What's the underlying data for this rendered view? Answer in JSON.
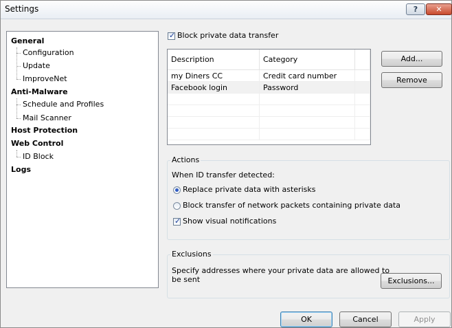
{
  "window": {
    "title": "Settings",
    "help_label": "?",
    "close_label": "✕"
  },
  "tree": [
    {
      "label": "General",
      "bold": true
    },
    {
      "label": "Configuration",
      "bold": false
    },
    {
      "label": "Update",
      "bold": false
    },
    {
      "label": "ImproveNet",
      "bold": false
    },
    {
      "label": "Anti-Malware",
      "bold": true
    },
    {
      "label": "Schedule and Profiles",
      "bold": false
    },
    {
      "label": "Mail Scanner",
      "bold": false
    },
    {
      "label": "Host Protection",
      "bold": true
    },
    {
      "label": "Web Control",
      "bold": true
    },
    {
      "label": "ID Block",
      "bold": false
    },
    {
      "label": "Logs",
      "bold": true
    }
  ],
  "block_transfer": {
    "label": "Block private data transfer",
    "checked": true
  },
  "table": {
    "columns": [
      "Description",
      "Category"
    ],
    "rows": [
      [
        "my Diners CC",
        "Credit card number"
      ],
      [
        "Facebook login",
        "Password"
      ]
    ]
  },
  "buttons": {
    "add": "Add...",
    "remove": "Remove",
    "exclusions": "Exclusions...",
    "ok": "OK",
    "cancel": "Cancel",
    "apply": "Apply"
  },
  "actions": {
    "title": "Actions",
    "prompt": "When ID transfer detected:",
    "radio_replace": "Replace private data with asterisks",
    "radio_block": "Block transfer of network packets containing private data",
    "selected": "replace",
    "notify_label": "Show visual notifications",
    "notify_checked": true
  },
  "exclusions": {
    "title": "Exclusions",
    "text_line1": "Specify addresses where your private data are allowed to",
    "text_line2": "be sent"
  },
  "checkmark": "✓"
}
